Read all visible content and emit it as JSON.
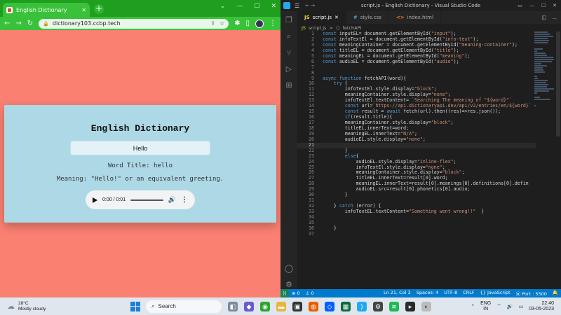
{
  "chrome": {
    "tab_title": "English Dictionary",
    "url": "dictionary103.ccbp.tech",
    "window_controls": [
      "⌄",
      "—",
      "☐",
      "✕"
    ]
  },
  "dictionary": {
    "title": "English Dictionary",
    "input_value": "Hello",
    "word_title": "Word Title: hello",
    "meaning": "Meaning: \"Hello!\" or an equivalent greeting.",
    "audio_time": "0:00 / 0:01"
  },
  "vscode": {
    "window_title": "script.js - English Dictionary - Visual Studio Code",
    "tabs": [
      {
        "icon": "JS",
        "label": "script.js",
        "active": true
      },
      {
        "icon": "#",
        "label": "style.css",
        "active": false
      },
      {
        "icon": "<>",
        "label": "index.html",
        "active": false
      }
    ],
    "breadcrumb": [
      "script.js",
      ">",
      "fetchAPI"
    ],
    "lines": [
      {
        "n": "1",
        "t": "const inputEL= document.getElementById(\"input\");"
      },
      {
        "n": "2",
        "t": "const infoTextEl = document.getElementById(\"info-text\");"
      },
      {
        "n": "3",
        "t": "const meaningContainer = document.getElementById(\"meaning-container\");"
      },
      {
        "n": "4",
        "t": "const titleEL = document.getElementById(\"title\");"
      },
      {
        "n": "5",
        "t": "const meaningEL = document.getElementById(\"meaning\");"
      },
      {
        "n": "6",
        "t": "const audioEL = document.getElementById(\"audio\");"
      },
      {
        "n": "7",
        "t": ""
      },
      {
        "n": "8",
        "t": ""
      },
      {
        "n": "9",
        "t": "async function fetchAPI(word){"
      },
      {
        "n": "10",
        "t": "    try {"
      },
      {
        "n": "11",
        "t": "        infoTextEl.style.display=\"block\";"
      },
      {
        "n": "12",
        "t": "        meaningContainer.style.display=\"none\";"
      },
      {
        "n": "13",
        "t": "        infoTextEl.textContent= `Searching The meaning of \"${word}\"`"
      },
      {
        "n": "14",
        "t": "        const url=`https://api.dictionaryapi.dev/api/v2/entries/en/${word}`"
      },
      {
        "n": "15",
        "t": "        const result = await fetch(url).then((res)=>res.json());"
      },
      {
        "n": "16",
        "t": "        if(result.title){"
      },
      {
        "n": "17",
        "t": "        meaningContainer.style.display=\"block\";"
      },
      {
        "n": "18",
        "t": "        titleEL.innerText=word;"
      },
      {
        "n": "19",
        "t": "        meaningEL.innerText=\"N/A\";"
      },
      {
        "n": "20",
        "t": "        audioEL.style.display=\"none\";"
      },
      {
        "n": "21",
        "t": ""
      },
      {
        "n": "22",
        "t": "        }"
      },
      {
        "n": "23",
        "t": "        else{"
      },
      {
        "n": "24",
        "t": "            audioEL.style.display=\"inline-flex\";"
      },
      {
        "n": "25",
        "t": "            infoTextEl.style.display=\"none\";"
      },
      {
        "n": "26",
        "t": "            meaningContainer.style.display=\"block\";"
      },
      {
        "n": "27",
        "t": "            titleEL.innerText=result[0].word;"
      },
      {
        "n": "28",
        "t": "            meaningEL.innerText=result[0].meanings[0].definitions[0].defin"
      },
      {
        "n": "29",
        "t": "            audioEL.src=result[0].phonetics[0].audio;"
      },
      {
        "n": "30",
        "t": "        }"
      },
      {
        "n": "31",
        "t": ""
      },
      {
        "n": "32",
        "t": "    } catch (error) {"
      },
      {
        "n": "33",
        "t": "        infoTextEL.textContent=\"Something went wrong!!\"  }"
      },
      {
        "n": "34",
        "t": ""
      },
      {
        "n": "35",
        "t": ""
      },
      {
        "n": "36",
        "t": "    }"
      },
      {
        "n": "37",
        "t": ""
      }
    ],
    "current_line": "21",
    "status": {
      "errors": "⊗ 0",
      "warnings": "⚠ 0",
      "position": "Ln 21, Col 3",
      "spaces": "Spaces: 4",
      "encoding": "UTF-8",
      "eol": "CRLF",
      "language": "{} JavaScript",
      "port": "⦿ Port : 5500"
    }
  },
  "taskbar": {
    "temperature": "28°C",
    "weather": "Mostly cloudy",
    "search_placeholder": "Search",
    "language_top": "ENG",
    "language_bottom": "IN",
    "time": "22:40",
    "date": "03-05-2023"
  },
  "colors": {
    "page_bg": "#fa8072",
    "card_bg": "#add8e6",
    "chrome_green": "#1f9e1f",
    "vscode_status": "#007acc"
  }
}
